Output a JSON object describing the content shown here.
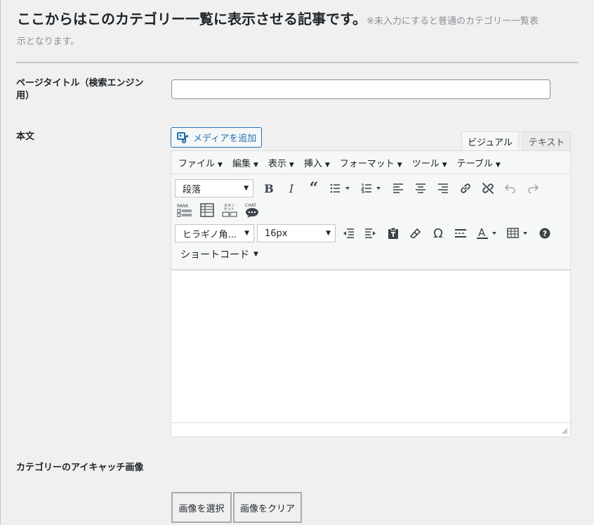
{
  "header": {
    "title": "ここからはこのカテゴリー一覧に表示させる記事です。",
    "note_part1": "※未入力にすると普通のカテゴリー一覧表",
    "note_part2": "示となります。"
  },
  "fields": {
    "page_title_label_line1": "ページタイトル（検索エンジン",
    "page_title_label_line2": "用）",
    "page_title_value": "",
    "body_label": "本文",
    "eyecatch_label": "カテゴリーのアイキャッチ画像"
  },
  "editor": {
    "add_media": "メディアを追加",
    "tab_visual": "ビジュアル",
    "tab_text": "テキスト",
    "menus": [
      "ファイル",
      "編集",
      "表示",
      "挿入",
      "フォーマット",
      "ツール",
      "テーブル"
    ],
    "format_select": "段落",
    "font_select": "ヒラギノ角...",
    "size_select": "16px",
    "shortcode_menu": "ショートコード",
    "rank_label": "RANK",
    "button_set_label1": "ボタン",
    "button_set_label2": "セット",
    "chat_label": "CHAT",
    "omega": "Ω",
    "help": "?"
  },
  "buttons": {
    "select_image": "画像を選択",
    "clear_image": "画像をクリア"
  },
  "colors": {
    "accent": "#2271b1",
    "background": "#f0f0f1"
  }
}
